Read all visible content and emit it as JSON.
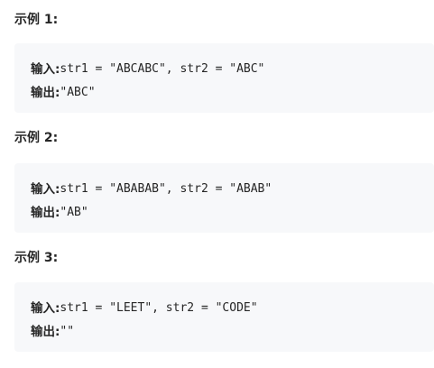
{
  "examples": [
    {
      "heading": "示例 1:",
      "input_label": "输入:",
      "input_value": "str1 = \"ABCABC\", str2 = \"ABC\"",
      "output_label": "输出:",
      "output_value": "\"ABC\""
    },
    {
      "heading": "示例 2:",
      "input_label": "输入:",
      "input_value": "str1 = \"ABABAB\", str2 = \"ABAB\"",
      "output_label": "输出:",
      "output_value": "\"AB\""
    },
    {
      "heading": "示例 3:",
      "input_label": "输入:",
      "input_value": "str1 = \"LEET\", str2 = \"CODE\"",
      "output_label": "输出:",
      "output_value": "\"\""
    }
  ]
}
